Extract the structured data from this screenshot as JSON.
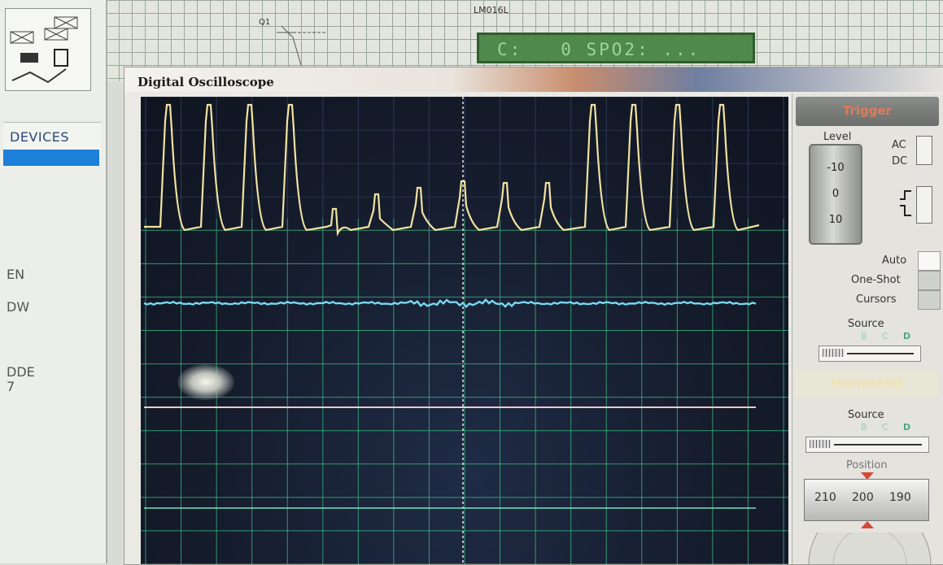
{
  "left_panel": {
    "devices_label": "DEVICES",
    "fragments": [
      "EN",
      "DW",
      "DDE",
      "7"
    ]
  },
  "schematic": {
    "component_label": "LM016L",
    "component_ref": "Q1",
    "lcd_text": "C:   0 SPO2: ..."
  },
  "window": {
    "title": "Digital Oscilloscope"
  },
  "trigger": {
    "header": "Trigger",
    "level_label": "Level",
    "ticks": [
      "-10",
      "0",
      "10"
    ],
    "ac_label": "AC",
    "dc_label": "DC",
    "auto_label": "Auto",
    "oneshot_label": "One-Shot",
    "cursors_label": "Cursors",
    "source_label": "Source",
    "source_channels": [
      "B",
      "C",
      "D"
    ]
  },
  "horizontal": {
    "header": "Horizontal",
    "source_label": "Source",
    "source_channels": [
      "B",
      "C",
      "D"
    ],
    "position_label": "Position",
    "position_values": [
      "210",
      "200",
      "190"
    ]
  },
  "colors": {
    "trace_a": "#f2e3a0",
    "trace_b": "#79d8f0",
    "trace_c": "#f0c8c8",
    "trace_d": "#7fe0c0",
    "grid": "#3fbf8a",
    "screen_bg": "#151c2c"
  }
}
